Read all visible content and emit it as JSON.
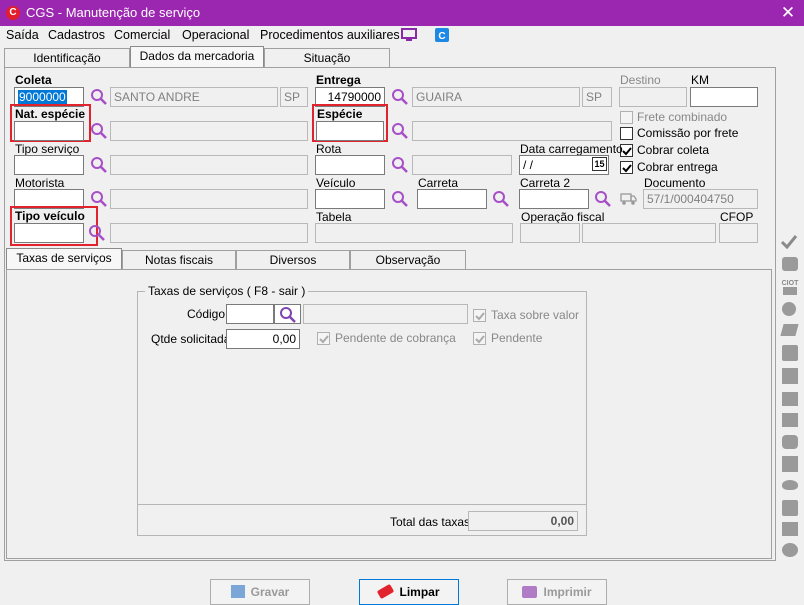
{
  "window": {
    "title": "CGS - Manutenção de serviço",
    "close_glyph": "✕",
    "app_icon": "C"
  },
  "menu": [
    "Saída",
    "Cadastros",
    "Comercial",
    "Operacional",
    "Procedimentos auxiliares"
  ],
  "menu_icons": [
    "monitor-icon",
    "calculator-icon"
  ],
  "top_tabs": [
    "Identificação",
    "Dados da mercadoria",
    "Situação"
  ],
  "active_top_tab": "Dados da mercadoria",
  "form": {
    "coleta": {
      "label": "Coleta",
      "code": "9000000",
      "city": "SANTO ANDRE",
      "uf": "SP"
    },
    "entrega": {
      "label": "Entrega",
      "code": "14790000",
      "city": "GUAIRA",
      "uf": "SP"
    },
    "destino": {
      "label": "Destino",
      "value": ""
    },
    "km": {
      "label": "KM",
      "value": ""
    },
    "nat_especie": {
      "label": "Nat. espécie",
      "value": ""
    },
    "especie": {
      "label": "Espécie",
      "value": ""
    },
    "tipo_servico": {
      "label": "Tipo serviço",
      "value": ""
    },
    "rota": {
      "label": "Rota",
      "value": ""
    },
    "data_carregamento": {
      "label": "Data carregamento",
      "value": " /  /",
      "cal_day": "15"
    },
    "motorista": {
      "label": "Motorista",
      "value": ""
    },
    "veiculo": {
      "label": "Veículo",
      "value": ""
    },
    "carreta": {
      "label": "Carreta",
      "value": ""
    },
    "carreta2": {
      "label": "Carreta 2",
      "value": ""
    },
    "documento": {
      "label": "Documento",
      "value": "57/1/000404750"
    },
    "tipo_veiculo": {
      "label": "Tipo veículo",
      "value": ""
    },
    "tabela": {
      "label": "Tabela",
      "value": ""
    },
    "operacao_fiscal": {
      "label": "Operação fiscal",
      "value": ""
    },
    "cfop": {
      "label": "CFOP",
      "value": ""
    },
    "checkboxes": [
      {
        "label": "Frete combinado",
        "checked": false,
        "enabled": false
      },
      {
        "label": "Comissão por frete",
        "checked": false,
        "enabled": true
      },
      {
        "label": "Cobrar coleta",
        "checked": true,
        "enabled": true
      },
      {
        "label": "Cobrar entrega",
        "checked": true,
        "enabled": true
      }
    ]
  },
  "bottom_tabs": [
    "Taxas de serviços",
    "Notas fiscais",
    "Diversos",
    "Observação"
  ],
  "active_bottom_tab": "Taxas de serviços",
  "taxas": {
    "group_title": "Taxas de serviços  ( F8 - sair )",
    "codigo_label": "Código",
    "codigo_value": "",
    "qtde_label": "Qtde solicitada",
    "qtde_value": "0,00",
    "taxa_sobre_valor": "Taxa sobre valor",
    "pendente_cobranca": "Pendente de cobrança",
    "pendente": "Pendente",
    "total_label": "Total das taxas",
    "total_value": "0,00"
  },
  "buttons": {
    "gravar": "Gravar",
    "limpar": "Limpar",
    "imprimir": "Imprimir"
  },
  "colors": {
    "title_bar": "#9b27b0",
    "accent_magnifier": "#a64fc6",
    "highlight": "#e0232d",
    "selection": "#0078d7"
  }
}
